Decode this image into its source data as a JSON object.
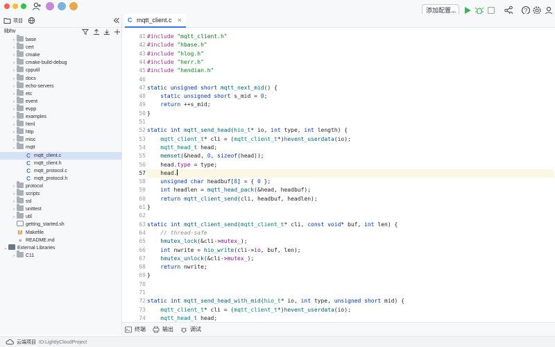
{
  "titlebar": {
    "run_config": "添加配置...",
    "colors": {
      "close": "#ff5f57",
      "minimize": "#febc2e",
      "maximize": "#28c840",
      "accent": "#3574f0"
    }
  },
  "editor_tab": {
    "label": "mqtt_client.c"
  },
  "sidebar": {
    "header_label": "项目",
    "root": "libhv",
    "items": [
      {
        "label": "base",
        "kind": "folder",
        "depth": 1
      },
      {
        "label": "cert",
        "kind": "folder",
        "depth": 1
      },
      {
        "label": "cmake",
        "kind": "folder",
        "depth": 1
      },
      {
        "label": "cmake-build-debug",
        "kind": "folder",
        "depth": 1
      },
      {
        "label": "cpputil",
        "kind": "folder",
        "depth": 1
      },
      {
        "label": "docs",
        "kind": "folder",
        "depth": 1
      },
      {
        "label": "echo-servers",
        "kind": "folder",
        "depth": 1
      },
      {
        "label": "etc",
        "kind": "folder",
        "depth": 1
      },
      {
        "label": "event",
        "kind": "folder",
        "depth": 1
      },
      {
        "label": "evpp",
        "kind": "folder",
        "depth": 1
      },
      {
        "label": "examples",
        "kind": "folder",
        "depth": 1
      },
      {
        "label": "html",
        "kind": "folder",
        "depth": 1
      },
      {
        "label": "http",
        "kind": "folder",
        "depth": 1
      },
      {
        "label": "misc",
        "kind": "folder",
        "depth": 1
      },
      {
        "label": "mqtt",
        "kind": "folder-open",
        "depth": 1
      },
      {
        "label": "mqtt_client.c",
        "kind": "c-file",
        "depth": 2,
        "selected": true
      },
      {
        "label": "mqtt_client.h",
        "kind": "c-file",
        "depth": 2
      },
      {
        "label": "mqtt_protocol.c",
        "kind": "c-file",
        "depth": 2
      },
      {
        "label": "mqtt_protocol.h",
        "kind": "c-file",
        "depth": 2
      },
      {
        "label": "protocol",
        "kind": "folder",
        "depth": 1
      },
      {
        "label": "scripts",
        "kind": "folder",
        "depth": 1
      },
      {
        "label": "ssl",
        "kind": "folder",
        "depth": 1
      },
      {
        "label": "unittest",
        "kind": "folder",
        "depth": 1
      },
      {
        "label": "util",
        "kind": "folder",
        "depth": 1
      },
      {
        "label": "getting_started.sh",
        "kind": "sh-file",
        "depth": 1
      },
      {
        "label": "Makefile",
        "kind": "make-file",
        "depth": 1
      },
      {
        "label": "README.md",
        "kind": "md-file",
        "depth": 1
      },
      {
        "label": "External Libraries",
        "kind": "lib-open",
        "depth": 0
      },
      {
        "label": "C11",
        "kind": "folder",
        "depth": 1
      }
    ]
  },
  "editor": {
    "current_line": 57,
    "lines": [
      {
        "n": "41",
        "t": [
          [
            "pp",
            "#include "
          ],
          [
            "str",
            "\"mqtt_client.h\""
          ]
        ]
      },
      {
        "n": "42",
        "t": [
          [
            "pp",
            "#include "
          ],
          [
            "str",
            "\"hbase.h\""
          ]
        ]
      },
      {
        "n": "43",
        "t": [
          [
            "pp",
            "#include "
          ],
          [
            "str",
            "\"hlog.h\""
          ]
        ]
      },
      {
        "n": "44",
        "t": [
          [
            "pp",
            "#include "
          ],
          [
            "str",
            "\"herr.h\""
          ]
        ]
      },
      {
        "n": "45",
        "t": [
          [
            "pp",
            "#include "
          ],
          [
            "str",
            "\"hendian.h\""
          ]
        ]
      },
      {
        "n": "46",
        "t": []
      },
      {
        "n": "47",
        "t": [
          [
            "kw",
            "static unsigned short "
          ],
          [
            "fn",
            "mqtt_next_mid"
          ],
          [
            "",
            "() {"
          ]
        ]
      },
      {
        "n": "48",
        "t": [
          [
            "",
            "    "
          ],
          [
            "kw",
            "static unsigned short "
          ],
          [
            "",
            "s_mid = "
          ],
          [
            "num",
            "0"
          ],
          [
            "",
            ";"
          ]
        ]
      },
      {
        "n": "49",
        "t": [
          [
            "",
            "    "
          ],
          [
            "kw",
            "return "
          ],
          [
            "",
            "++s_mid;"
          ]
        ]
      },
      {
        "n": "50",
        "t": [
          [
            "",
            "}"
          ]
        ]
      },
      {
        "n": "51",
        "t": []
      },
      {
        "n": "52",
        "t": [
          [
            "kw",
            "static int "
          ],
          [
            "fn",
            "mqtt_send_head"
          ],
          [
            "",
            "("
          ],
          [
            "ty",
            "hio_t"
          ],
          [
            "",
            "* io, "
          ],
          [
            "kw",
            "int "
          ],
          [
            "",
            "type, "
          ],
          [
            "kw",
            "int "
          ],
          [
            "",
            "length) {"
          ]
        ]
      },
      {
        "n": "53",
        "t": [
          [
            "",
            "    "
          ],
          [
            "ty",
            "mqtt_client_t"
          ],
          [
            "",
            "* cli = ("
          ],
          [
            "ty",
            "mqtt_client_t"
          ],
          [
            "",
            "*)"
          ],
          [
            "fn",
            "hevent_userdata"
          ],
          [
            "",
            "(io);"
          ]
        ]
      },
      {
        "n": "54",
        "t": [
          [
            "",
            "    "
          ],
          [
            "ty",
            "mqtt_head_t "
          ],
          [
            "",
            "head;"
          ]
        ]
      },
      {
        "n": "55",
        "t": [
          [
            "",
            "    "
          ],
          [
            "fn",
            "memset"
          ],
          [
            "",
            "(&head, "
          ],
          [
            "num",
            "0"
          ],
          [
            "",
            ", "
          ],
          [
            "kw",
            "sizeof"
          ],
          [
            "",
            "(head));"
          ]
        ]
      },
      {
        "n": "56",
        "t": [
          [
            "",
            "    head."
          ],
          [
            "fld",
            "type"
          ],
          [
            "",
            " = type;"
          ]
        ]
      },
      {
        "n": "57",
        "t": [
          [
            "",
            "    head."
          ]
        ],
        "caret": true
      },
      {
        "n": "58",
        "t": [
          [
            "",
            "    "
          ],
          [
            "kw",
            "unsigned char "
          ],
          [
            "",
            "headbuf["
          ],
          [
            "num",
            "8"
          ],
          [
            "",
            "] = { "
          ],
          [
            "num",
            "0"
          ],
          [
            "",
            " };"
          ]
        ]
      },
      {
        "n": "59",
        "t": [
          [
            "",
            "    "
          ],
          [
            "kw",
            "int "
          ],
          [
            "",
            "headlen = "
          ],
          [
            "fn",
            "mqtt_head_pack"
          ],
          [
            "",
            "(&head, headbuf);"
          ]
        ]
      },
      {
        "n": "60",
        "t": [
          [
            "",
            "    "
          ],
          [
            "kw",
            "return "
          ],
          [
            "fn",
            "mqtt_client_send"
          ],
          [
            "",
            "(cli, headbuf, headlen);"
          ]
        ]
      },
      {
        "n": "61",
        "t": [
          [
            "",
            "}"
          ]
        ]
      },
      {
        "n": "62",
        "t": []
      },
      {
        "n": "63",
        "t": [
          [
            "kw",
            "static int "
          ],
          [
            "fn",
            "mqtt_client_send"
          ],
          [
            "",
            "("
          ],
          [
            "ty",
            "mqtt_client_t"
          ],
          [
            "",
            "* cli, "
          ],
          [
            "kw",
            "const void"
          ],
          [
            "",
            "* buf, "
          ],
          [
            "kw",
            "int "
          ],
          [
            "",
            "len) {"
          ]
        ]
      },
      {
        "n": "64",
        "t": [
          [
            "",
            "    "
          ],
          [
            "cm",
            "// thread-safe"
          ]
        ]
      },
      {
        "n": "65",
        "t": [
          [
            "",
            "    "
          ],
          [
            "fn",
            "hmutex_lock"
          ],
          [
            "",
            "(&cli->"
          ],
          [
            "fld",
            "mutex_"
          ],
          [
            "",
            ");"
          ]
        ]
      },
      {
        "n": "66",
        "t": [
          [
            "",
            "    "
          ],
          [
            "kw",
            "int "
          ],
          [
            "",
            "nwrite = "
          ],
          [
            "fn",
            "hio_write"
          ],
          [
            "",
            "(cli->"
          ],
          [
            "fld",
            "io"
          ],
          [
            "",
            ", buf, len);"
          ]
        ]
      },
      {
        "n": "67",
        "t": [
          [
            "",
            "    "
          ],
          [
            "fn",
            "hmutex_unlock"
          ],
          [
            "",
            "(&cli->"
          ],
          [
            "fld",
            "mutex_"
          ],
          [
            "",
            ");"
          ]
        ]
      },
      {
        "n": "68",
        "t": [
          [
            "",
            "    "
          ],
          [
            "kw",
            "return "
          ],
          [
            "",
            "nwrite;"
          ]
        ]
      },
      {
        "n": "69",
        "t": [
          [
            "",
            "}"
          ]
        ]
      },
      {
        "n": "70",
        "t": []
      },
      {
        "n": "71",
        "t": []
      },
      {
        "n": "72",
        "t": [
          [
            "kw",
            "static int "
          ],
          [
            "fn",
            "mqtt_send_head_with_mid"
          ],
          [
            "",
            "("
          ],
          [
            "ty",
            "hio_t"
          ],
          [
            "",
            "* io, "
          ],
          [
            "kw",
            "int "
          ],
          [
            "",
            "type, "
          ],
          [
            "kw",
            "unsigned short "
          ],
          [
            "",
            "mid) {"
          ]
        ]
      },
      {
        "n": "73",
        "t": [
          [
            "",
            "    "
          ],
          [
            "ty",
            "mqtt_client_t"
          ],
          [
            "",
            "* cli = ("
          ],
          [
            "ty",
            "mqtt_client_t"
          ],
          [
            "",
            "*)"
          ],
          [
            "fn",
            "hevent_userdata"
          ],
          [
            "",
            "(io);"
          ]
        ]
      },
      {
        "n": "74",
        "t": [
          [
            "",
            "    "
          ],
          [
            "ty",
            "mqtt_head_t "
          ],
          [
            "",
            "head;"
          ]
        ]
      }
    ]
  },
  "bottom_tabs": [
    {
      "label": "终端",
      "icon": "terminal-icon"
    },
    {
      "label": "输出",
      "icon": "output-icon"
    },
    {
      "label": "调试",
      "icon": "debug-icon"
    }
  ],
  "statusbar": {
    "project": "云端项目",
    "id": "ID:LightlyCloudProject"
  }
}
